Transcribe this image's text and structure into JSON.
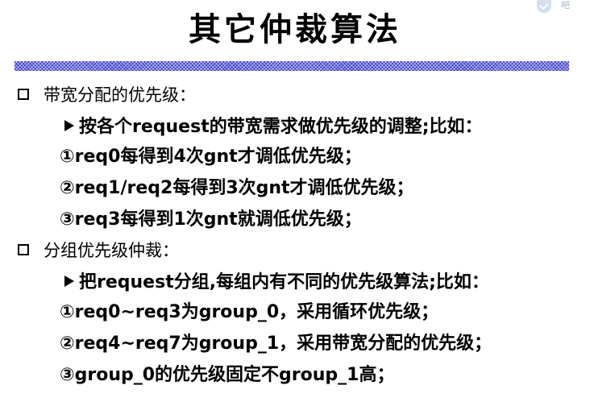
{
  "title": "其它仲裁算法",
  "corner_mark": "吧",
  "sections": [
    {
      "heading": "带宽分配的优先级：",
      "intro": "按各个request的带宽需求做优先级的调整;比如：",
      "items": [
        "①req0每得到4次gnt才调低优先级；",
        "②req1/req2每得到3次gnt才调低优先级；",
        "③req3每得到1次gnt就调低优先级；"
      ]
    },
    {
      "heading": "分组优先级仲裁：",
      "intro": "把request分组,每组内有不同的优先级算法;比如：",
      "items": [
        "①req0~req3为group_0，采用循环优先级；",
        "②req4~req7为group_1，采用带宽分配的优先级；",
        "③group_0的优先级固定不group_1高；"
      ]
    }
  ]
}
